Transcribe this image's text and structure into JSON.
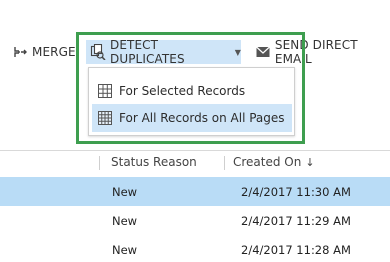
{
  "toolbar": {
    "merge_label": "MERGE",
    "detect_label": "DETECT DUPLICATES",
    "send_label": "SEND DIRECT EMAIL"
  },
  "dropdown": {
    "items": [
      {
        "label": "For Selected Records"
      },
      {
        "label": "For All Records on All Pages"
      }
    ]
  },
  "grid": {
    "columns": [
      {
        "label": "Status Reason"
      },
      {
        "label": "Created On",
        "sort": "↓"
      }
    ],
    "rows": [
      {
        "status": "New",
        "created_on": "2/4/2017 11:30 AM",
        "selected": true
      },
      {
        "status": "New",
        "created_on": "2/4/2017 11:29 AM",
        "selected": false
      },
      {
        "status": "New",
        "created_on": "2/4/2017 11:28 AM",
        "selected": false
      }
    ]
  },
  "colors": {
    "accent_highlight": "#cfe5f8",
    "selected_row": "#b9dcf6",
    "callout_border": "#3e9e4f"
  },
  "icons": [
    "merge-icon",
    "detect-duplicates-icon",
    "chevron-down-icon",
    "envelope-icon",
    "table-grid-icon"
  ]
}
